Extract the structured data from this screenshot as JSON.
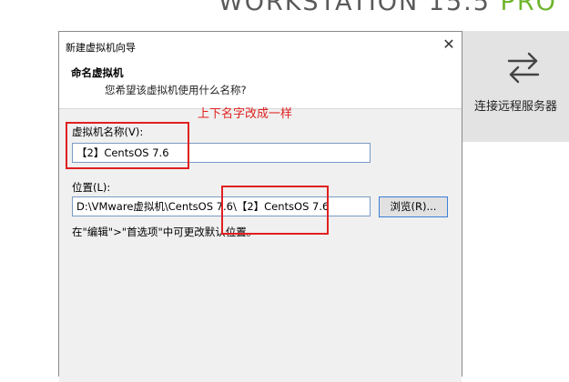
{
  "background": {
    "product_title": "WORKSTATION 15.5",
    "product_badge": "PRO",
    "remote_label": "连接远程服务器"
  },
  "dialog": {
    "window_title": "新建虚拟机向导",
    "close_glyph": "✕",
    "header_title": "命名虚拟机",
    "header_subtitle": "您希望该虚拟机使用什么名称?",
    "name_label": "虚拟机名称(V):",
    "name_value": "【2】CentsOS 7.6",
    "location_label": "位置(L):",
    "location_value": "D:\\VMware虚拟机\\CentsOS 7.6\\【2】CentsOS 7.6",
    "browse_label": "浏览(R)...",
    "hint_text": "在\"编辑\">\"首选项\"中可更改默认位置。"
  },
  "annotation": {
    "text": "上下名字改成一样"
  },
  "colors": {
    "annotation": "#e02020",
    "accent_green": "#6fb52c",
    "panel_gray": "#e3e3e3"
  }
}
